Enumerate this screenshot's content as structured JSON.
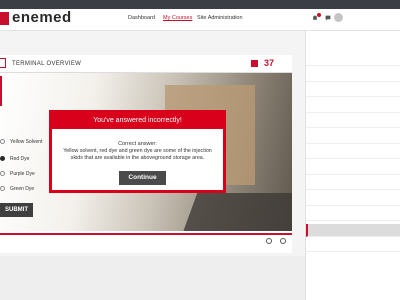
{
  "header": {
    "logo_text": "enemed",
    "nav": [
      "Dashboard",
      "My Courses",
      "Site Administration"
    ]
  },
  "slide": {
    "title": "TERMINAL OVERVIEW",
    "counter": "37",
    "options": [
      {
        "label": "Yellow Solvent",
        "selected": false
      },
      {
        "label": "Red Dye",
        "selected": true
      },
      {
        "label": "Purple Dye",
        "selected": false
      },
      {
        "label": "Green Dye",
        "selected": false
      }
    ],
    "submit_label": "SUBMIT",
    "progress": 1.0
  },
  "modal": {
    "title": "You've answered incorrectly!",
    "answer_label": "Correct answer:",
    "answer_text": "Yellow solvent, red dye and green dye are some of the injection skids that are available in the aboveground storage area.",
    "continue_label": "Continue"
  },
  "sidebar": {
    "selected_index": 11
  },
  "colors": {
    "accent": "#c8102e",
    "modal_border": "#d9001b",
    "button": "#4a4a4a"
  }
}
